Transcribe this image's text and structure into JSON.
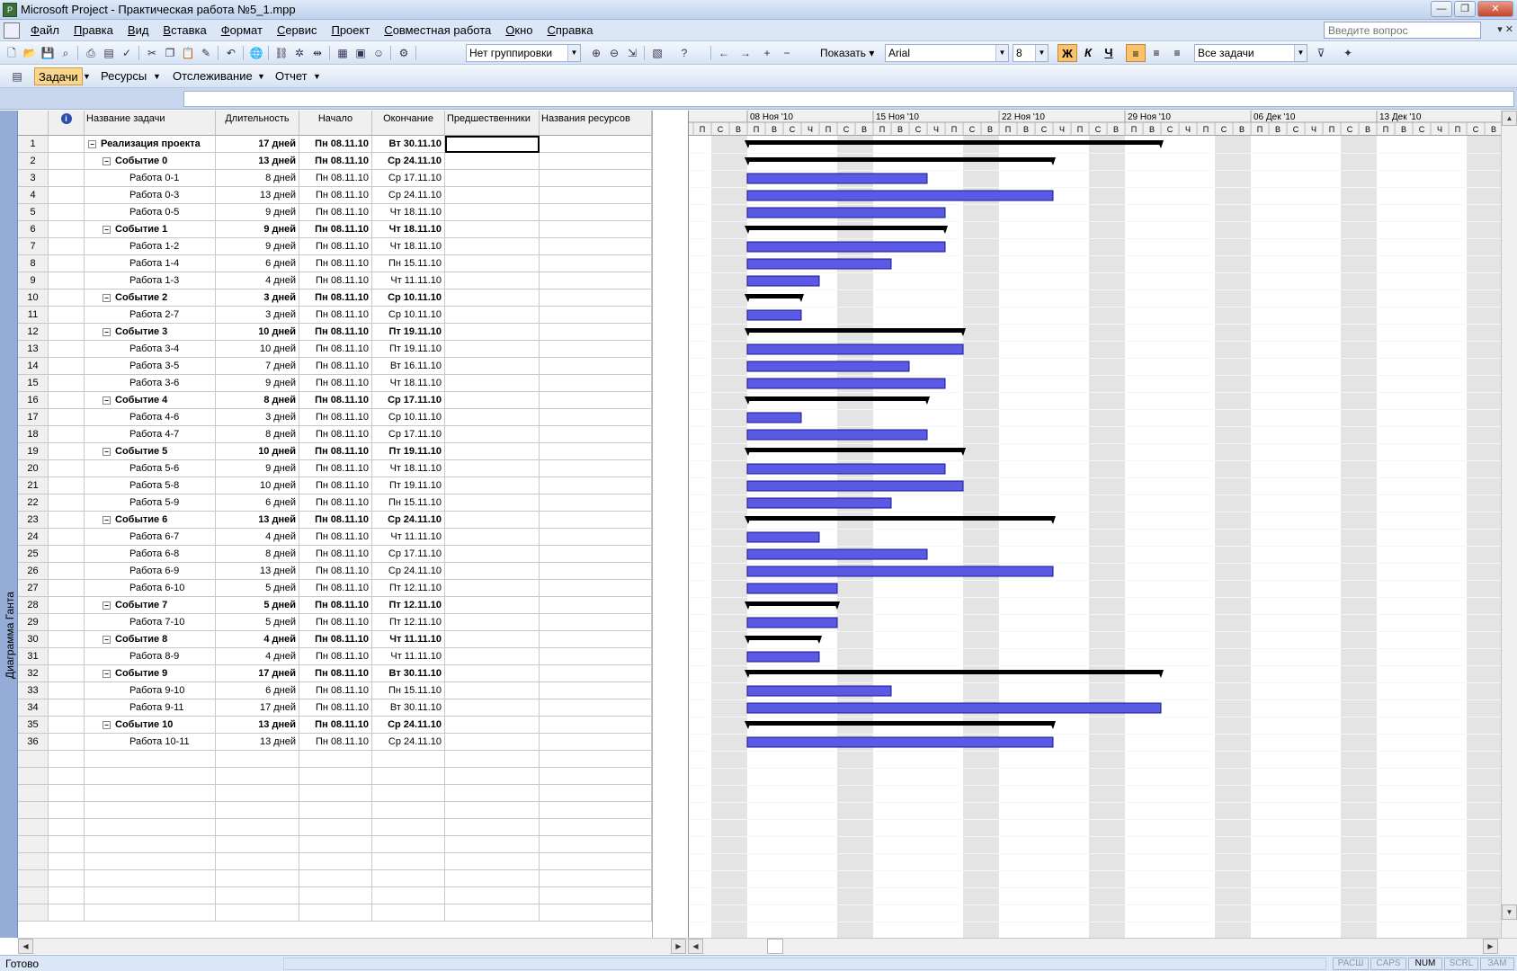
{
  "window": {
    "title": "Microsoft Project - Практическая работа №5_1.mpp",
    "app_icon": "project-icon",
    "btn_min": "—",
    "btn_max": "❐",
    "btn_close": "✕"
  },
  "menu": {
    "items": [
      "Файл",
      "Правка",
      "Вид",
      "Вставка",
      "Формат",
      "Сервис",
      "Проект",
      "Совместная работа",
      "Окно",
      "Справка"
    ],
    "help_placeholder": "Введите вопрос",
    "doc_controls": "▾ ✕"
  },
  "toolbar1": {
    "grouping": "Нет группировки",
    "show_label": "Показать",
    "font": "Arial",
    "font_size": "8",
    "bold": "Ж",
    "italic": "К",
    "underline": "Ч",
    "filter": "Все задачи"
  },
  "toolbar2": {
    "items": [
      "Задачи",
      "Ресурсы",
      "Отслеживание",
      "Отчет"
    ]
  },
  "viewbar": {
    "label": "Диаграмма Ганта"
  },
  "table": {
    "headers": {
      "info": "i",
      "name": "Название задачи",
      "duration": "Длительность",
      "start": "Начало",
      "finish": "Окончание",
      "pred": "Предшественники",
      "res": "Названия ресурсов"
    },
    "rows": [
      {
        "id": "1",
        "name": "Реализация проекта",
        "dur": "17 дней",
        "start": "Пн 08.11.10",
        "finish": "Вт 30.11.10",
        "level": 0,
        "summary": true,
        "days": 17
      },
      {
        "id": "2",
        "name": "Событие 0",
        "dur": "13 дней",
        "start": "Пн 08.11.10",
        "finish": "Ср 24.11.10",
        "level": 1,
        "summary": true,
        "days": 13
      },
      {
        "id": "3",
        "name": "Работа 0-1",
        "dur": "8 дней",
        "start": "Пн 08.11.10",
        "finish": "Ср 17.11.10",
        "level": 2,
        "summary": false,
        "days": 8
      },
      {
        "id": "4",
        "name": "Работа 0-3",
        "dur": "13 дней",
        "start": "Пн 08.11.10",
        "finish": "Ср 24.11.10",
        "level": 2,
        "summary": false,
        "days": 13
      },
      {
        "id": "5",
        "name": "Работа 0-5",
        "dur": "9 дней",
        "start": "Пн 08.11.10",
        "finish": "Чт 18.11.10",
        "level": 2,
        "summary": false,
        "days": 9
      },
      {
        "id": "6",
        "name": "Событие 1",
        "dur": "9 дней",
        "start": "Пн 08.11.10",
        "finish": "Чт 18.11.10",
        "level": 1,
        "summary": true,
        "days": 9
      },
      {
        "id": "7",
        "name": "Работа 1-2",
        "dur": "9 дней",
        "start": "Пн 08.11.10",
        "finish": "Чт 18.11.10",
        "level": 2,
        "summary": false,
        "days": 9
      },
      {
        "id": "8",
        "name": "Работа 1-4",
        "dur": "6 дней",
        "start": "Пн 08.11.10",
        "finish": "Пн 15.11.10",
        "level": 2,
        "summary": false,
        "days": 6
      },
      {
        "id": "9",
        "name": "Работа 1-3",
        "dur": "4 дней",
        "start": "Пн 08.11.10",
        "finish": "Чт 11.11.10",
        "level": 2,
        "summary": false,
        "days": 4
      },
      {
        "id": "10",
        "name": "Событие 2",
        "dur": "3 дней",
        "start": "Пн 08.11.10",
        "finish": "Ср 10.11.10",
        "level": 1,
        "summary": true,
        "days": 3
      },
      {
        "id": "11",
        "name": "Работа 2-7",
        "dur": "3 дней",
        "start": "Пн 08.11.10",
        "finish": "Ср 10.11.10",
        "level": 2,
        "summary": false,
        "days": 3
      },
      {
        "id": "12",
        "name": "Событие 3",
        "dur": "10 дней",
        "start": "Пн 08.11.10",
        "finish": "Пт 19.11.10",
        "level": 1,
        "summary": true,
        "days": 10
      },
      {
        "id": "13",
        "name": "Работа 3-4",
        "dur": "10 дней",
        "start": "Пн 08.11.10",
        "finish": "Пт 19.11.10",
        "level": 2,
        "summary": false,
        "days": 10
      },
      {
        "id": "14",
        "name": "Работа 3-5",
        "dur": "7 дней",
        "start": "Пн 08.11.10",
        "finish": "Вт 16.11.10",
        "level": 2,
        "summary": false,
        "days": 7
      },
      {
        "id": "15",
        "name": "Работа 3-6",
        "dur": "9 дней",
        "start": "Пн 08.11.10",
        "finish": "Чт 18.11.10",
        "level": 2,
        "summary": false,
        "days": 9
      },
      {
        "id": "16",
        "name": "Событие 4",
        "dur": "8 дней",
        "start": "Пн 08.11.10",
        "finish": "Ср 17.11.10",
        "level": 1,
        "summary": true,
        "days": 8
      },
      {
        "id": "17",
        "name": "Работа 4-6",
        "dur": "3 дней",
        "start": "Пн 08.11.10",
        "finish": "Ср 10.11.10",
        "level": 2,
        "summary": false,
        "days": 3
      },
      {
        "id": "18",
        "name": "Работа 4-7",
        "dur": "8 дней",
        "start": "Пн 08.11.10",
        "finish": "Ср 17.11.10",
        "level": 2,
        "summary": false,
        "days": 8
      },
      {
        "id": "19",
        "name": "Событие 5",
        "dur": "10 дней",
        "start": "Пн 08.11.10",
        "finish": "Пт 19.11.10",
        "level": 1,
        "summary": true,
        "days": 10
      },
      {
        "id": "20",
        "name": "Работа 5-6",
        "dur": "9 дней",
        "start": "Пн 08.11.10",
        "finish": "Чт 18.11.10",
        "level": 2,
        "summary": false,
        "days": 9
      },
      {
        "id": "21",
        "name": "Работа 5-8",
        "dur": "10 дней",
        "start": "Пн 08.11.10",
        "finish": "Пт 19.11.10",
        "level": 2,
        "summary": false,
        "days": 10
      },
      {
        "id": "22",
        "name": "Работа 5-9",
        "dur": "6 дней",
        "start": "Пн 08.11.10",
        "finish": "Пн 15.11.10",
        "level": 2,
        "summary": false,
        "days": 6
      },
      {
        "id": "23",
        "name": "Событие 6",
        "dur": "13 дней",
        "start": "Пн 08.11.10",
        "finish": "Ср 24.11.10",
        "level": 1,
        "summary": true,
        "days": 13
      },
      {
        "id": "24",
        "name": "Работа 6-7",
        "dur": "4 дней",
        "start": "Пн 08.11.10",
        "finish": "Чт 11.11.10",
        "level": 2,
        "summary": false,
        "days": 4
      },
      {
        "id": "25",
        "name": "Работа 6-8",
        "dur": "8 дней",
        "start": "Пн 08.11.10",
        "finish": "Ср 17.11.10",
        "level": 2,
        "summary": false,
        "days": 8
      },
      {
        "id": "26",
        "name": "Работа 6-9",
        "dur": "13 дней",
        "start": "Пн 08.11.10",
        "finish": "Ср 24.11.10",
        "level": 2,
        "summary": false,
        "days": 13
      },
      {
        "id": "27",
        "name": "Работа 6-10",
        "dur": "5 дней",
        "start": "Пн 08.11.10",
        "finish": "Пт 12.11.10",
        "level": 2,
        "summary": false,
        "days": 5
      },
      {
        "id": "28",
        "name": "Событие 7",
        "dur": "5 дней",
        "start": "Пн 08.11.10",
        "finish": "Пт 12.11.10",
        "level": 1,
        "summary": true,
        "days": 5
      },
      {
        "id": "29",
        "name": "Работа 7-10",
        "dur": "5 дней",
        "start": "Пн 08.11.10",
        "finish": "Пт 12.11.10",
        "level": 2,
        "summary": false,
        "days": 5
      },
      {
        "id": "30",
        "name": "Событие 8",
        "dur": "4 дней",
        "start": "Пн 08.11.10",
        "finish": "Чт 11.11.10",
        "level": 1,
        "summary": true,
        "days": 4
      },
      {
        "id": "31",
        "name": "Работа 8-9",
        "dur": "4 дней",
        "start": "Пн 08.11.10",
        "finish": "Чт 11.11.10",
        "level": 2,
        "summary": false,
        "days": 4
      },
      {
        "id": "32",
        "name": "Событие 9",
        "dur": "17 дней",
        "start": "Пн 08.11.10",
        "finish": "Вт 30.11.10",
        "level": 1,
        "summary": true,
        "days": 17
      },
      {
        "id": "33",
        "name": "Работа 9-10",
        "dur": "6 дней",
        "start": "Пн 08.11.10",
        "finish": "Пн 15.11.10",
        "level": 2,
        "summary": false,
        "days": 6
      },
      {
        "id": "34",
        "name": "Работа 9-11",
        "dur": "17 дней",
        "start": "Пн 08.11.10",
        "finish": "Вт 30.11.10",
        "level": 2,
        "summary": false,
        "days": 17
      },
      {
        "id": "35",
        "name": "Событие 10",
        "dur": "13 дней",
        "start": "Пн 08.11.10",
        "finish": "Ср 24.11.10",
        "level": 1,
        "summary": true,
        "days": 13
      },
      {
        "id": "36",
        "name": "Работа 10-11",
        "dur": "13 дней",
        "start": "Пн 08.11.10",
        "finish": "Ср 24.11.10",
        "level": 2,
        "summary": false,
        "days": 13
      }
    ]
  },
  "gantt": {
    "weeks": [
      "08 Ноя '10",
      "15 Ноя '10",
      "22 Ноя '10",
      "29 Ноя '10",
      "06 Дек '10",
      "13 Дек '10"
    ],
    "days": [
      "Ч",
      "П",
      "С",
      "В",
      "П",
      "В",
      "С",
      "Ч",
      "П",
      "С",
      "В",
      "П",
      "В",
      "С",
      "Ч",
      "П",
      "С",
      "В",
      "П",
      "В",
      "С",
      "Ч",
      "П",
      "С",
      "В",
      "П",
      "В",
      "С",
      "Ч",
      "П",
      "С",
      "В",
      "П",
      "В",
      "С",
      "Ч",
      "П",
      "С",
      "В",
      "П",
      "В",
      "С",
      "Ч",
      "П",
      "С",
      "В",
      "П",
      "В",
      "С",
      "Ч",
      "П",
      "С",
      "В",
      "П",
      "В",
      "С",
      "Ч",
      "П",
      "С",
      "В",
      "П",
      "В"
    ],
    "bar_color": "#5a5ae6",
    "summary_color": "#000000"
  },
  "status": {
    "text": "Готово",
    "panels": [
      "РАСШ",
      "CAPS",
      "NUM",
      "SCRL",
      "ЗАМ"
    ],
    "active": "NUM"
  }
}
